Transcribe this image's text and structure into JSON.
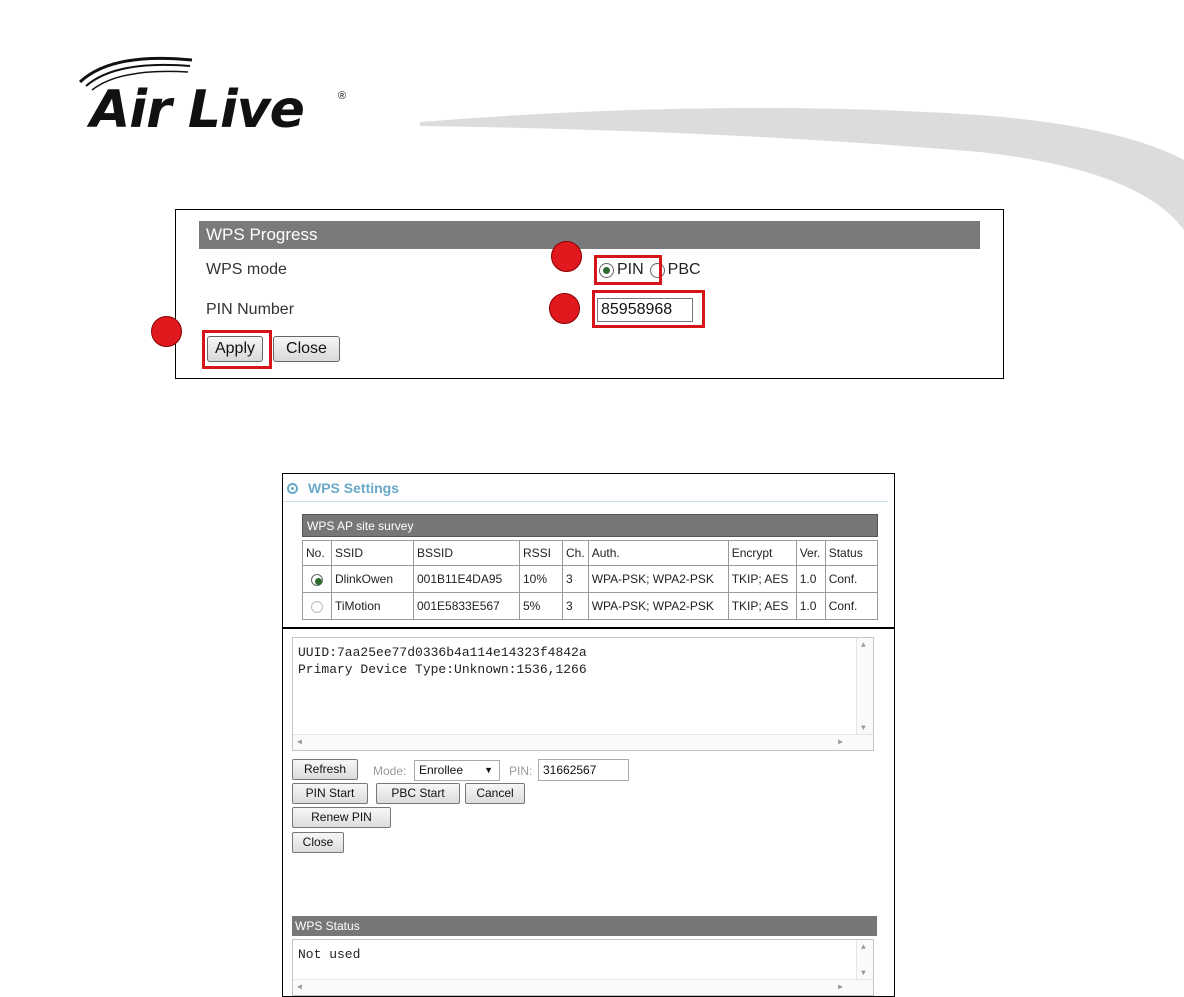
{
  "logo": {
    "text": "Air Live",
    "reg_mark": "®"
  },
  "wps_progress": {
    "header": "WPS Progress",
    "wps_mode_label": "WPS mode",
    "modes": [
      {
        "label": "PIN",
        "selected": true
      },
      {
        "label": "PBC",
        "selected": false
      }
    ],
    "pin_number_label": "PIN Number",
    "pin_number_value": "85958968",
    "apply_label": "Apply",
    "close_label": "Close",
    "highlight_color": "#d8141b"
  },
  "wps_settings": {
    "title": "WPS Settings",
    "survey_header": "WPS AP site survey",
    "columns": [
      "No.",
      "SSID",
      "BSSID",
      "RSSI",
      "Ch.",
      "Auth.",
      "Encrypt",
      "Ver.",
      "Status"
    ],
    "rows": [
      {
        "selected": true,
        "ssid": "DlinkOwen",
        "bssid": "001B11E4DA95",
        "rssi": "10%",
        "ch": "3",
        "auth": "WPA-PSK; WPA2-PSK",
        "encrypt": "TKIP; AES",
        "ver": "1.0",
        "status": "Conf."
      },
      {
        "selected": false,
        "ssid": "TiMotion",
        "bssid": "001E5833E567",
        "rssi": "5%",
        "ch": "3",
        "auth": "WPA-PSK; WPA2-PSK",
        "encrypt": "TKIP; AES",
        "ver": "1.0",
        "status": "Conf."
      }
    ],
    "accent_color": "#6aa9c9"
  },
  "device_info": {
    "line1": "UUID:7aa25ee77d0336b4a114e14323f4842a",
    "line2": "Primary Device Type:Unknown:1536,1266"
  },
  "controls": {
    "refresh_label": "Refresh",
    "mode_label": "Mode:",
    "mode_value": "Enrollee",
    "pin_label": "PIN:",
    "pin_value": "31662567",
    "pin_start_label": "PIN Start",
    "pbc_start_label": "PBC Start",
    "cancel_label": "Cancel",
    "renew_pin_label": "Renew PIN",
    "close_label": "Close"
  },
  "wps_status": {
    "header": "WPS Status",
    "value": "Not used"
  }
}
